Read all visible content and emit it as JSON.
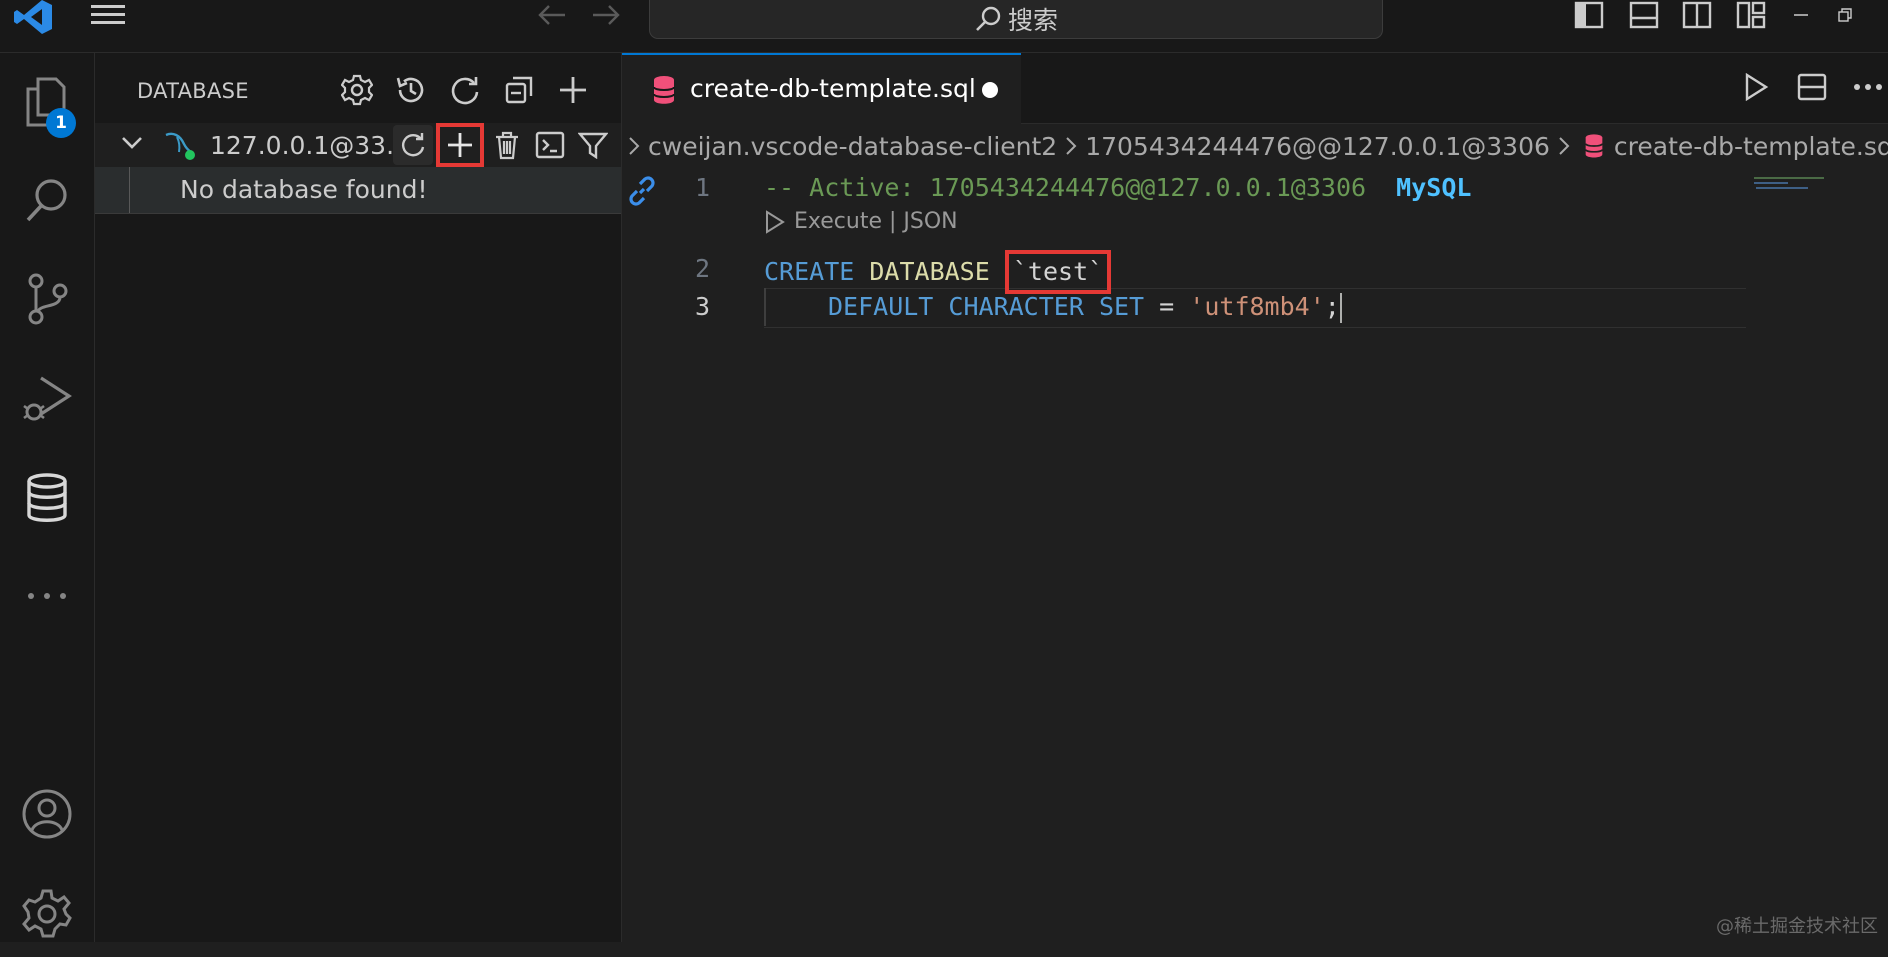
{
  "titlebar": {
    "search_placeholder": "搜索",
    "icons": [
      "vscode-logo-icon",
      "menu-icon",
      "back-arrow-icon",
      "forward-arrow-icon",
      "toggle-primary-sidebar-icon",
      "toggle-panel-icon",
      "toggle-secondary-sidebar-icon",
      "customize-layout-icon",
      "minimize-icon",
      "restore-icon"
    ]
  },
  "activity_bar": {
    "explorer_badge": "1",
    "items": [
      "explorer-icon",
      "search-icon",
      "source-control-icon",
      "run-debug-icon",
      "database-icon",
      "more-icon",
      "account-icon",
      "settings-gear-icon"
    ]
  },
  "sidebar": {
    "title": "DATABASE",
    "connection_label": "127.0.0.1@33...",
    "empty_message": "No database found!"
  },
  "editor": {
    "tab_label": "create-db-template.sql",
    "breadcrumb": [
      "cweijan.vscode-database-client2",
      "1705434244476@@127.0.0.1@3306",
      "create-db-template.sql",
      "..."
    ],
    "codelens": "Execute | JSON",
    "lines": [
      {
        "num": "1",
        "comment": "-- Active: 1705434244476@@127.0.0.1@3306",
        "db": "MySQL"
      },
      {
        "num": "2",
        "kw1": "CREATE",
        "kw2": "DATABASE",
        "name": "`test`"
      },
      {
        "num": "3",
        "kw1": "DEFAULT",
        "kw2": "CHARACTER",
        "kw3": "SET",
        "op": "=",
        "str": "'utf8mb4'",
        "end": ";"
      }
    ]
  },
  "watermark": "@稀土掘金技术社区",
  "colors": {
    "accent": "#0078d4",
    "highlight": "#e53935",
    "status_dot": "#22c55e"
  }
}
